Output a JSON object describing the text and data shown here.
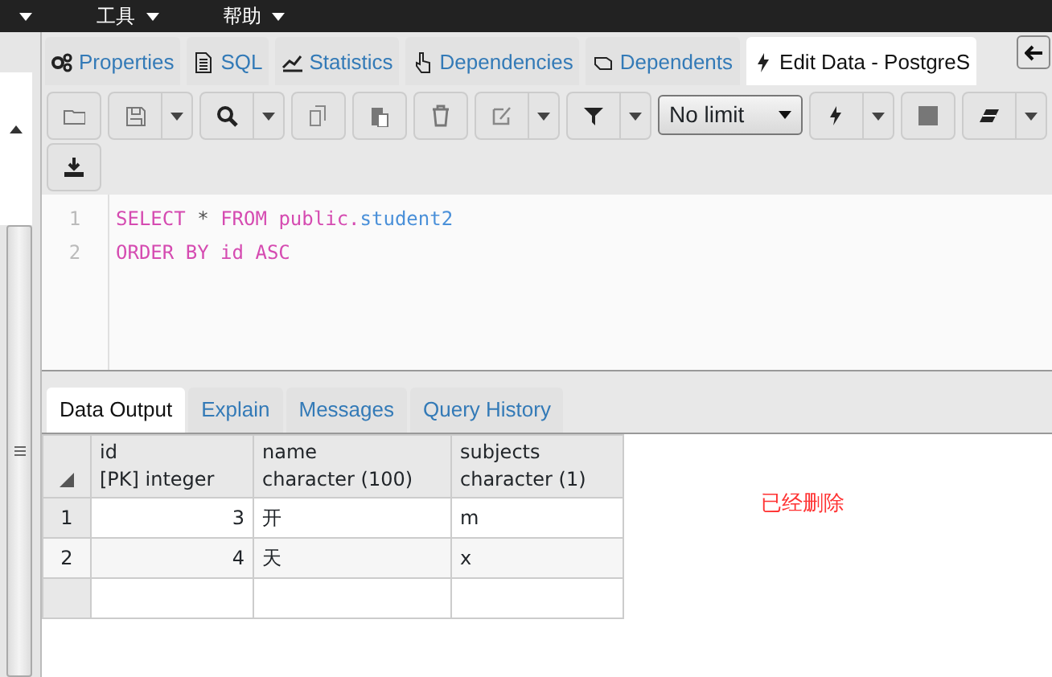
{
  "menu_bar": {
    "items": [
      {
        "label": "工具"
      },
      {
        "label": "帮助"
      }
    ]
  },
  "tabs": [
    {
      "label": "Properties",
      "selected": false
    },
    {
      "label": "SQL",
      "selected": false
    },
    {
      "label": "Statistics",
      "selected": false
    },
    {
      "label": "Dependencies",
      "selected": false
    },
    {
      "label": "Dependents",
      "selected": false
    },
    {
      "label": "Edit Data - PostgreS",
      "selected": true
    }
  ],
  "toolbar": [
    {
      "kind": "button",
      "dropdown": false
    },
    {
      "kind": "button",
      "dropdown": true
    },
    {
      "kind": "button",
      "dropdown": true
    },
    {
      "kind": "button",
      "dropdown": false
    },
    {
      "kind": "button",
      "dropdown": false
    },
    {
      "kind": "button",
      "dropdown": false
    },
    {
      "kind": "button",
      "dropdown": true
    },
    {
      "kind": "button",
      "dropdown": true
    },
    {
      "kind": "select",
      "value": "No limit"
    },
    {
      "kind": "button",
      "dropdown": true
    },
    {
      "kind": "button",
      "dropdown": false
    },
    {
      "kind": "button",
      "dropdown": true
    },
    {
      "kind": "button",
      "dropdown": false
    }
  ],
  "editor": {
    "lines": [
      {
        "number": "1",
        "tokens": [
          {
            "kind": "keyword",
            "text": "SELECT"
          },
          {
            "kind": "operator",
            "text": "*"
          },
          {
            "kind": "keyword",
            "text": "FROM"
          },
          {
            "kind": "keyword",
            "text": "public."
          },
          {
            "kind": "identifier",
            "text": "student2"
          }
        ]
      },
      {
        "number": "2",
        "tokens": [
          {
            "kind": "keyword",
            "text": "ORDER"
          },
          {
            "kind": "keyword",
            "text": "BY"
          },
          {
            "kind": "keyword",
            "text": "id"
          },
          {
            "kind": "keyword",
            "text": "ASC"
          }
        ]
      }
    ]
  },
  "result_tabs": [
    {
      "label": "Data Output",
      "selected": true
    },
    {
      "label": "Explain",
      "selected": false
    },
    {
      "label": "Messages",
      "selected": false
    },
    {
      "label": "Query History",
      "selected": false
    }
  ],
  "table": {
    "columns": [
      {
        "name": "id",
        "type": "[PK] integer"
      },
      {
        "name": "name",
        "type": "character (100)"
      },
      {
        "name": "subjects",
        "type": "character (1)"
      }
    ],
    "rows": [
      {
        "number": "1",
        "cells": [
          "3",
          "开",
          "m"
        ]
      },
      {
        "number": "2",
        "cells": [
          "4",
          "天",
          "x"
        ]
      }
    ]
  },
  "note": {
    "text": "已经删除",
    "color": "#ff3333"
  }
}
